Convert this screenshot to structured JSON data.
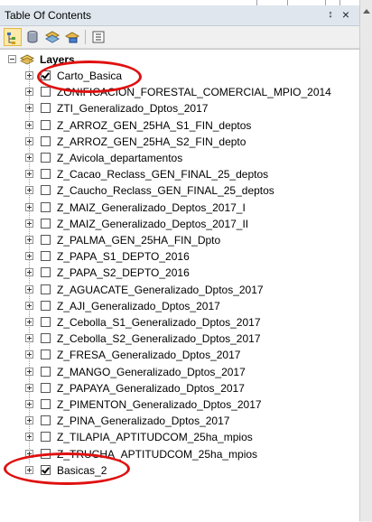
{
  "window": {
    "title": "Table Of Contents",
    "pin_glyph": "↕",
    "close_glyph": "×"
  },
  "toolbar": {
    "icons": [
      "list-by-drawing-order-icon",
      "list-by-source-icon",
      "list-by-visibility-icon",
      "list-by-selection-icon",
      "options-icon"
    ]
  },
  "tree": {
    "root_label": "Layers",
    "items": [
      {
        "label": "Carto_Basica",
        "checked": true,
        "expanded": false
      },
      {
        "label": "ZONIFICACION_FORESTAL_COMERCIAL_MPIO_2014",
        "checked": false,
        "expanded": false
      },
      {
        "label": "ZTI_Generalizado_Dptos_2017",
        "checked": false,
        "expanded": false
      },
      {
        "label": "Z_ARROZ_GEN_25HA_S1_FIN_deptos",
        "checked": false,
        "expanded": false
      },
      {
        "label": "Z_ARROZ_GEN_25HA_S2_FIN_depto",
        "checked": false,
        "expanded": false
      },
      {
        "label": "Z_Avicola_departamentos",
        "checked": false,
        "expanded": false
      },
      {
        "label": "Z_Cacao_Reclass_GEN_FINAL_25_deptos",
        "checked": false,
        "expanded": false
      },
      {
        "label": "Z_Caucho_Reclass_GEN_FINAL_25_deptos",
        "checked": false,
        "expanded": false
      },
      {
        "label": "Z_MAIZ_Generalizado_Deptos_2017_I",
        "checked": false,
        "expanded": false
      },
      {
        "label": "Z_MAIZ_Generalizado_Deptos_2017_II",
        "checked": false,
        "expanded": false
      },
      {
        "label": "Z_PALMA_GEN_25HA_FIN_Dpto",
        "checked": false,
        "expanded": false
      },
      {
        "label": "Z_PAPA_S1_DEPTO_2016",
        "checked": false,
        "expanded": false
      },
      {
        "label": "Z_PAPA_S2_DEPTO_2016",
        "checked": false,
        "expanded": false
      },
      {
        "label": "Z_AGUACATE_Generalizado_Dptos_2017",
        "checked": false,
        "expanded": false
      },
      {
        "label": "Z_AJI_Generalizado_Dptos_2017",
        "checked": false,
        "expanded": false
      },
      {
        "label": "Z_Cebolla_S1_Generalizado_Dptos_2017",
        "checked": false,
        "expanded": false
      },
      {
        "label": "Z_Cebolla_S2_Generalizado_Dptos_2017",
        "checked": false,
        "expanded": false
      },
      {
        "label": "Z_FRESA_Generalizado_Dptos_2017",
        "checked": false,
        "expanded": false
      },
      {
        "label": "Z_MANGO_Generalizado_Dptos_2017",
        "checked": false,
        "expanded": false
      },
      {
        "label": "Z_PAPAYA_Generalizado_Dptos_2017",
        "checked": false,
        "expanded": false
      },
      {
        "label": "Z_PIMENTON_Generalizado_Dptos_2017",
        "checked": false,
        "expanded": false
      },
      {
        "label": "Z_PINA_Generalizado_Dptos_2017",
        "checked": false,
        "expanded": false
      },
      {
        "label": "Z_TILAPIA_APTITUDCOM_25ha_mpios",
        "checked": false,
        "expanded": false
      },
      {
        "label": "Z_TRUCHA_APTITUDCOM_25ha_mpios",
        "checked": false,
        "expanded": false
      },
      {
        "label": "Basicas_2",
        "checked": true,
        "expanded": false
      }
    ]
  },
  "colors": {
    "annotation": "#e01010",
    "active_tool": "#fde9a9"
  }
}
